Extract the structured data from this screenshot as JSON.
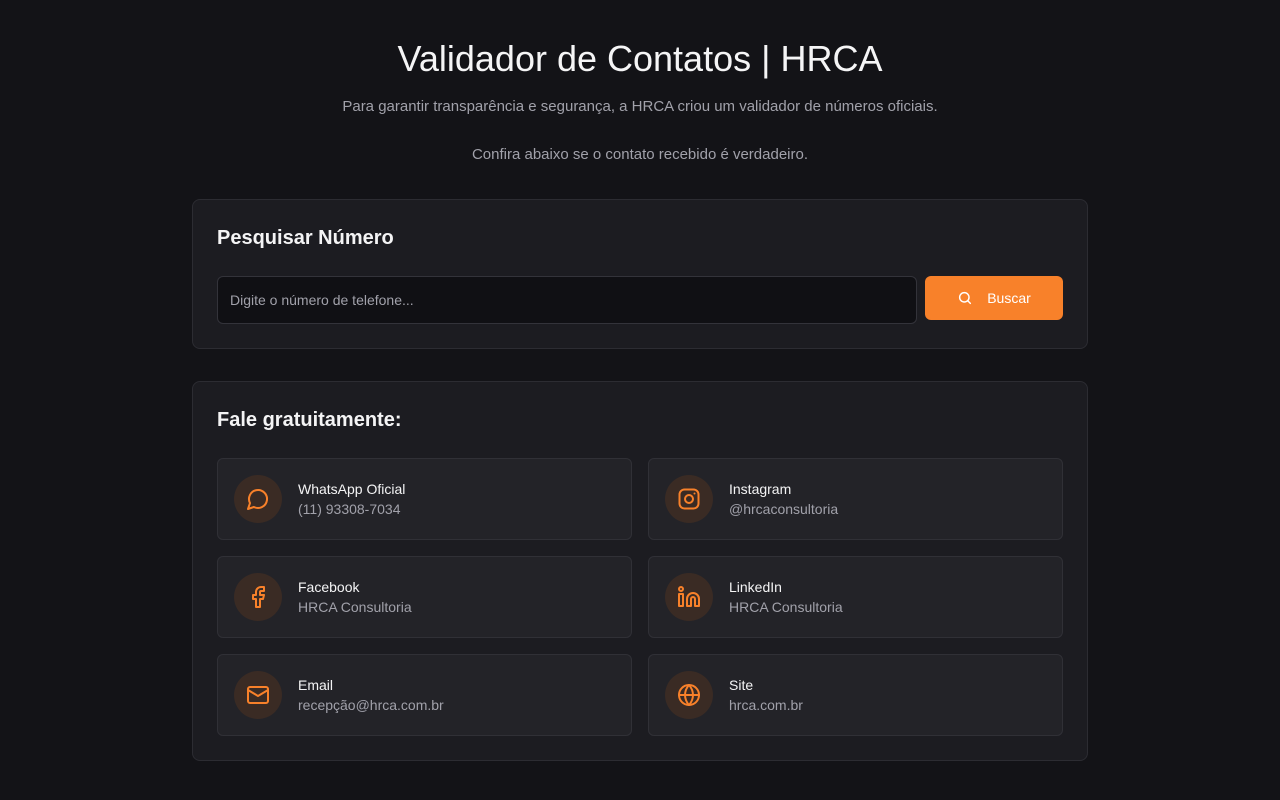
{
  "header": {
    "title": "Validador de Contatos | HRCA",
    "subtitle_line1": "Para garantir transparência e segurança, a HRCA criou um validador de números oficiais.",
    "subtitle_line2": "Confira abaixo se o contato recebido é verdadeiro."
  },
  "search": {
    "title": "Pesquisar Número",
    "value": "",
    "placeholder": "Digite o número de telefone...",
    "button_label": "Buscar",
    "button_icon": "search-icon"
  },
  "contacts": {
    "title": "Fale gratuitamente:",
    "items": [
      {
        "label": "WhatsApp Oficial",
        "value": "(11) 93308-7034",
        "icon": "message-circle-icon"
      },
      {
        "label": "Instagram",
        "value": "@hrcaconsultoria",
        "icon": "instagram-icon"
      },
      {
        "label": "Facebook",
        "value": "HRCA Consultoria",
        "icon": "facebook-icon"
      },
      {
        "label": "LinkedIn",
        "value": "HRCA Consultoria",
        "icon": "linkedin-icon"
      },
      {
        "label": "Email",
        "value": "recepção@hrca.com.br",
        "icon": "mail-icon"
      },
      {
        "label": "Site",
        "value": "hrca.com.br",
        "icon": "globe-icon"
      }
    ]
  },
  "colors": {
    "background": "#131317",
    "card": "#1c1c21",
    "accent": "#f8812a",
    "muted_text": "#a1a1aa"
  }
}
